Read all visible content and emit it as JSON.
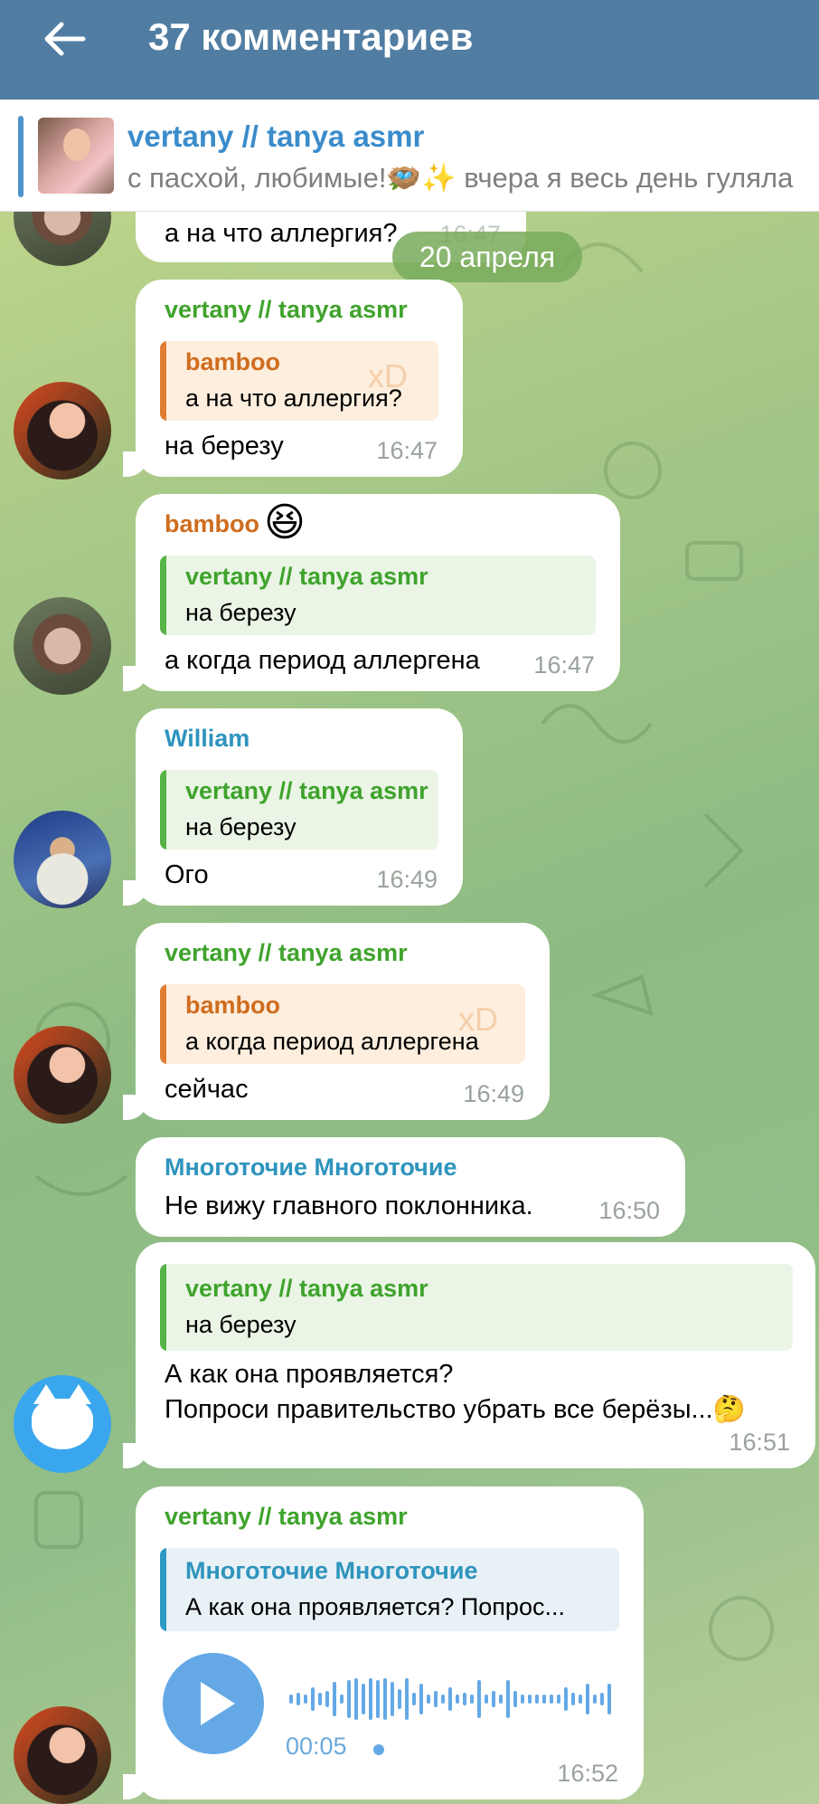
{
  "header": {
    "title": "37 комментариев"
  },
  "pinned": {
    "name": "vertany // tanya asmr",
    "text": "с пасхой, любимые!🪺✨ вчера я весь день гуляла"
  },
  "partial_message": {
    "text": "а на что аллергия?",
    "time": "16:47"
  },
  "date_separator": "20 апреля",
  "messages": [
    {
      "sender": "vertany // tanya asmr",
      "quote": {
        "name": "bamboo",
        "text": "а на что аллергия?",
        "decor": "xD"
      },
      "text": "на березу",
      "time": "16:47"
    },
    {
      "sender": "bamboo",
      "sender_emoji": "😆",
      "quote": {
        "name": "vertany // tanya asmr",
        "text": "на березу"
      },
      "text": "а когда период аллергена",
      "time": "16:47"
    },
    {
      "sender": "William",
      "quote": {
        "name": "vertany // tanya asmr",
        "text": "на березу"
      },
      "text": "Ого",
      "time": "16:49"
    },
    {
      "sender": "vertany // tanya asmr",
      "quote": {
        "name": "bamboo",
        "text": "а когда период аллергена",
        "decor": "xD"
      },
      "text": "сейчас",
      "time": "16:49"
    },
    {
      "sender": "Многоточие Многоточие",
      "text": "Не вижу главного поклонника.",
      "time": "16:50"
    },
    {
      "quote": {
        "name": "vertany // tanya asmr",
        "text": "на березу"
      },
      "text_line1": "А как она проявляется?",
      "text_line2": "Попроси правительство убрать все берёзы...🤔",
      "time": "16:51"
    },
    {
      "sender": "vertany // tanya asmr",
      "quote": {
        "name": "Многоточие Многоточие",
        "text": "А как она проявляется? Попрос..."
      },
      "voice_duration": "00:05",
      "time": "16:52"
    }
  ],
  "colors": {
    "header": "#517da2",
    "accent_green": "#3fa32c",
    "accent_orange": "#cf6d1f",
    "accent_teal": "#2e94bd",
    "voice": "#64a9e6"
  },
  "icons": [
    "back-arrow-icon",
    "play-icon",
    "waveform-icon"
  ]
}
